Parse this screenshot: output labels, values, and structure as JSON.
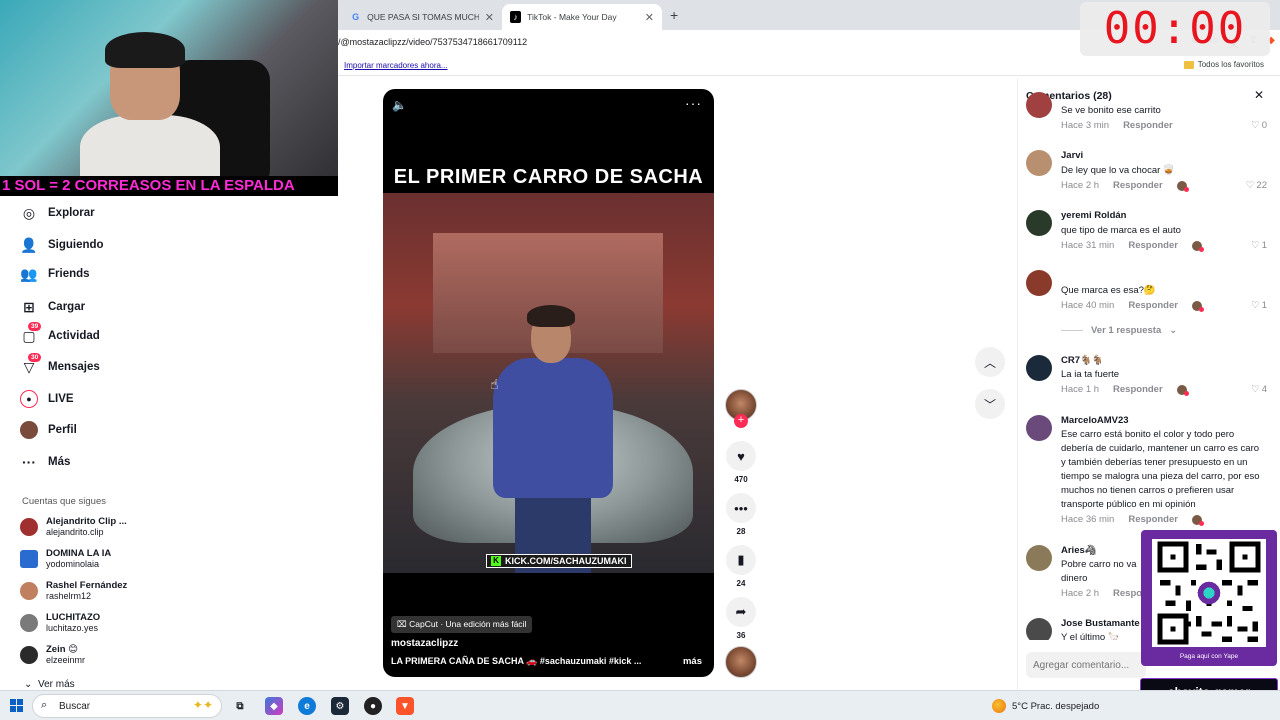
{
  "browser": {
    "tabs": [
      {
        "title": "QUE PASA SI TOMAS MUCHA AGUA",
        "favicon": "google-icon",
        "active": false
      },
      {
        "title": "TikTok - Make Your Day",
        "favicon": "tiktok-icon",
        "active": true
      }
    ],
    "url": "/@mostazaclipzz/video/7537534718661709112",
    "bookmarks": {
      "import": "Importar marcadores ahora...",
      "all": "Todos los favoritos"
    }
  },
  "webcam": {
    "banner": "1 SOL = 2 CORREASOS EN LA ESPALDA"
  },
  "timer": "00:00",
  "nav": {
    "items": [
      {
        "label": "Explorar",
        "icon": "compass-icon"
      },
      {
        "label": "Siguiendo",
        "icon": "following-icon"
      },
      {
        "label": "Friends",
        "icon": "friends-icon"
      },
      {
        "label": "Cargar",
        "icon": "upload-icon"
      },
      {
        "label": "Actividad",
        "icon": "activity-icon",
        "badge": "39"
      },
      {
        "label": "Mensajes",
        "icon": "messages-icon",
        "badge": "30"
      },
      {
        "label": "LIVE",
        "icon": "live-icon"
      },
      {
        "label": "Perfil",
        "icon": "profile-icon"
      },
      {
        "label": "Más",
        "icon": "more-icon"
      }
    ],
    "following_title": "Cuentas que sigues",
    "following": [
      {
        "name": "Alejandrito Clip ...",
        "handle": "alejandrito.clip",
        "color": "#a03030"
      },
      {
        "name": "DOMINA LA IA",
        "handle": "yodominolaia",
        "color": "#2a6bd0"
      },
      {
        "name": "Rashel Fernández",
        "handle": "rashelrm12",
        "color": "#c08060"
      },
      {
        "name": "LUCHITAZO",
        "handle": "luchitazo.yes",
        "color": "#7a7a7a"
      },
      {
        "name": "Zein 😊",
        "handle": "elzeeinmr",
        "color": "#2a2a2a"
      }
    ],
    "see_more": "Ver más"
  },
  "video": {
    "title": "EL PRIMER CARRO DE SACHA",
    "kick_text": "KICK.COM/SACHAUZUMAKI",
    "capcut": "CapCut · Una edición más fácil",
    "author": "mostazaclipzz",
    "description": "LA PRIMERA CAÑA DE SACHA 🚗  #sachauzumaki #kick ...",
    "more": "más"
  },
  "actions": {
    "likes": "470",
    "comments": "28",
    "saves": "24",
    "shares": "36"
  },
  "comments": {
    "title": "Comentarios (28)",
    "reply_label": "Responder",
    "view_replies": "Ver 1 respuesta",
    "input_placeholder": "Agregar comentario...",
    "items": [
      {
        "user": "",
        "text": "Se ve bonito ese carrito",
        "time": "Hace 3 min",
        "likes": "0",
        "creator_liked": false,
        "color": "#a04040"
      },
      {
        "user": "Jarvi",
        "text": "De ley que lo va chocar 🥃",
        "time": "Hace 2 h",
        "likes": "22",
        "creator_liked": true,
        "color": "#b89070"
      },
      {
        "user": "yeremi Roldán",
        "text": "que tipo de marca es el auto",
        "time": "Hace 31 min",
        "likes": "1",
        "creator_liked": true,
        "color": "#2a3a2a"
      },
      {
        "user": "",
        "text": "Que marca es esa?🤔",
        "time": "Hace 40 min",
        "likes": "1",
        "creator_liked": true,
        "color": "#8a3a2a"
      },
      {
        "user": "CR7🐐🐐",
        "text": "La ia ta fuerte",
        "time": "Hace 1 h",
        "likes": "4",
        "creator_liked": true,
        "color": "#1a2a3a"
      },
      {
        "user": "MarceloAMV23",
        "text": "Ese carro está bonito el color y todo pero debería de cuidarlo, mantener un carro es caro y también deberías tener presupuesto en un tiempo se malogra una pieza del carro, por eso muchos no tienen carros o prefieren usar transporte público en mi opinión",
        "time": "Hace 36 min",
        "likes": "1",
        "creator_liked": true,
        "color": "#6a4a7a"
      },
      {
        "user": "Aries🦓",
        "text": "Pobre carro no va dinero",
        "time": "Hace 2 h",
        "likes": "",
        "creator_liked": false,
        "color": "#8a7a5a"
      },
      {
        "user": "Jose Bustamante",
        "text": "Y el último 🦙",
        "time": "",
        "likes": "",
        "creator_liked": false,
        "color": "#4a4a4a"
      }
    ]
  },
  "qr": {
    "caption": "Paga aquí con Yape"
  },
  "streamer": "shavito-gamer",
  "taskbar": {
    "search": "Buscar",
    "weather": "5°C  Prac. despejado"
  }
}
